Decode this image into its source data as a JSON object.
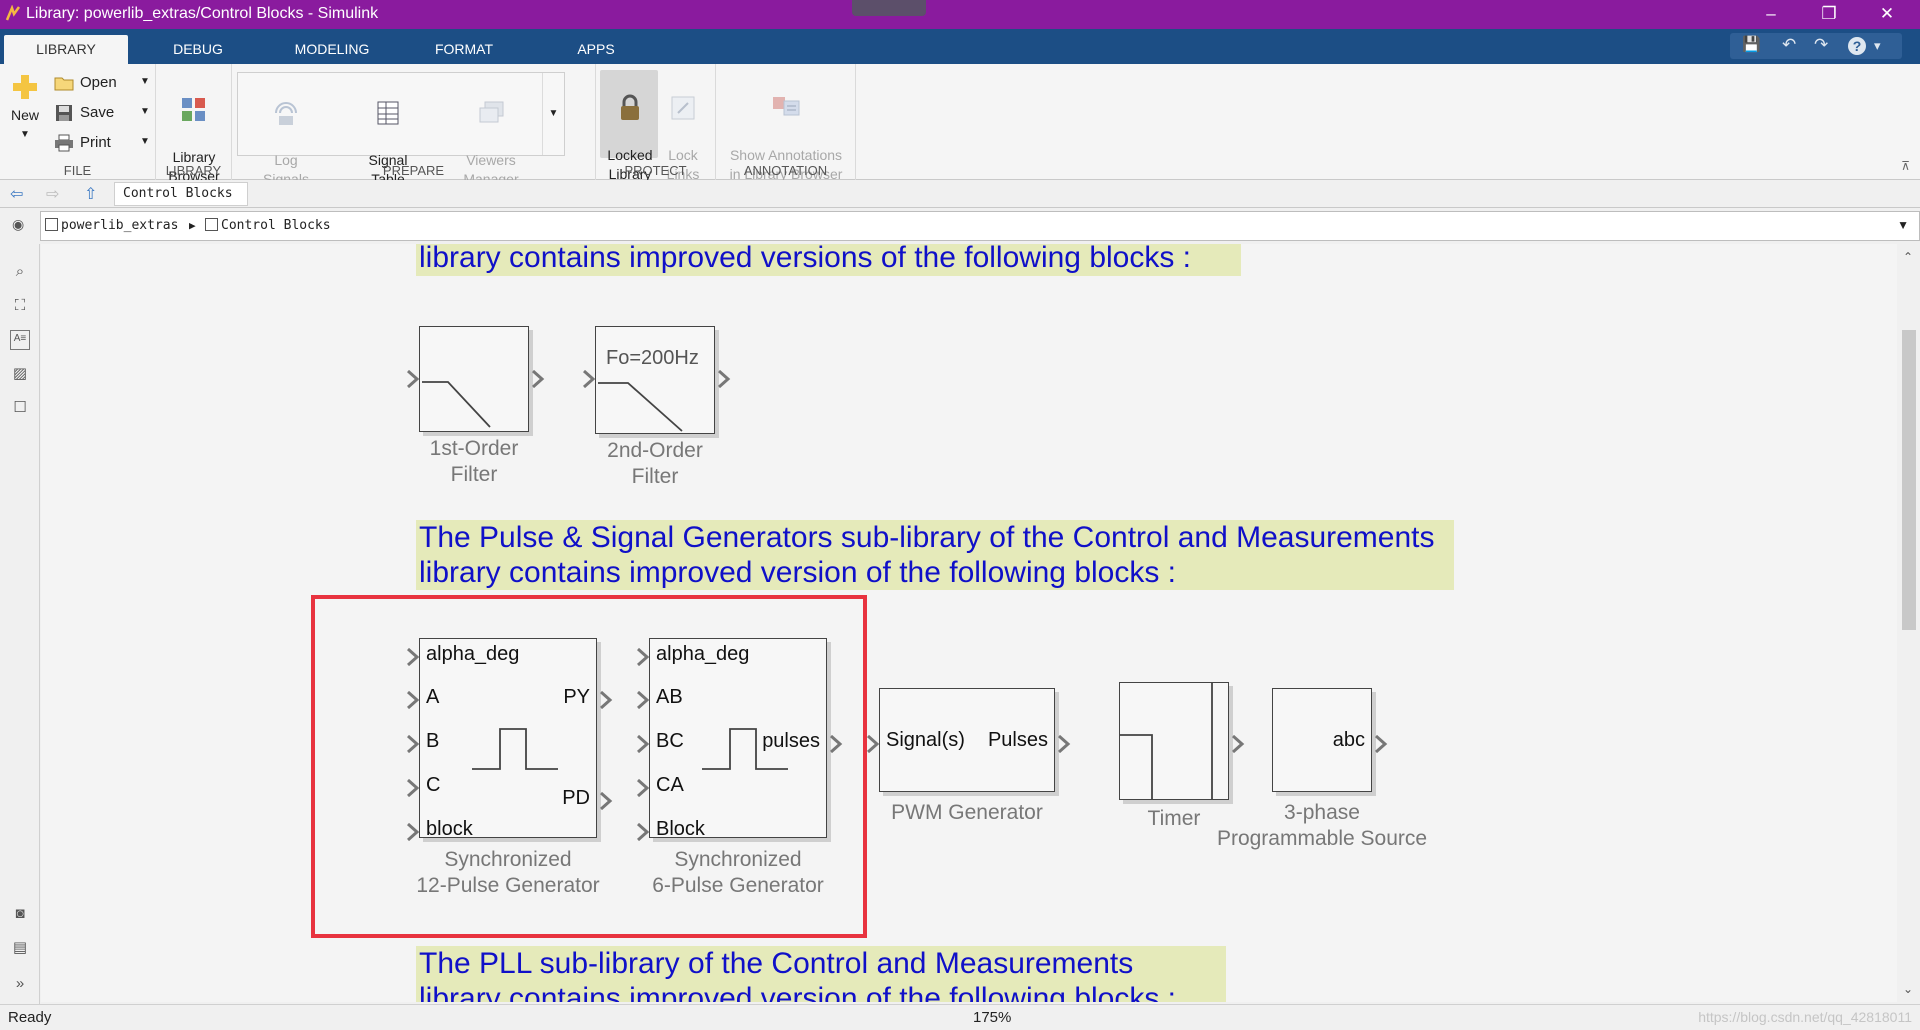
{
  "window": {
    "title": "Library: powerlib_extras/Control  Blocks - Simulink",
    "minimize": "–",
    "restore": "❐",
    "close": "✕"
  },
  "tabs": [
    "LIBRARY",
    "DEBUG",
    "MODELING",
    "FORMAT",
    "APPS"
  ],
  "quick_access": {
    "save": "💾",
    "undo": "↶",
    "redo": "↷",
    "help": "?",
    "more": "▾"
  },
  "ribbon": {
    "file": {
      "caption": "FILE",
      "new_label": "New",
      "open_label": "Open",
      "save_label": "Save",
      "print_label": "Print"
    },
    "library": {
      "caption": "LIBRARY",
      "library_browser_label": "Library\nBrowser"
    },
    "prepare": {
      "caption": "PREPARE",
      "log_signals_label": "Log\nSignals",
      "signal_table_label": "Signal\nTable",
      "viewers_manager_label": "Viewers\nManager"
    },
    "protect": {
      "caption": "PROTECT",
      "locked_library_label": "Locked\nLibrary",
      "lock_links_label": "Lock\nLinks"
    },
    "annotation": {
      "caption": "ANNOTATION",
      "show_annotations_label": "Show Annotations\nin Library Browser"
    }
  },
  "nav": {
    "back": "⇦",
    "forward": "⇨",
    "up": "⇧",
    "tab_label": "Control  Blocks"
  },
  "address": {
    "crumb_root": "powerlib_extras",
    "crumb_sep": "▶",
    "crumb_current": "Control  Blocks",
    "dropdown": "▼"
  },
  "canvas": {
    "annotations": [
      "library contains improved versions of the following blocks :",
      "The Pulse & Signal Generators sub-library of the Control and Measurements\nlibrary contains improved version of the following blocks :",
      "The PLL sub-library of the Control and Measurements\nlibrary contains improved version of the following blocks :"
    ],
    "blocks": {
      "first_order_filter": {
        "name": "1st-Order\nFilter"
      },
      "second_order_filter": {
        "name": "2nd-Order\nFilter",
        "param": "Fo=200Hz"
      },
      "sync12": {
        "name": "Synchronized\n12-Pulse Generator",
        "in_ports": [
          "alpha_deg",
          "A",
          "B",
          "C",
          "block"
        ],
        "out_ports": [
          "PY",
          "PD"
        ]
      },
      "sync6": {
        "name": "Synchronized\n6-Pulse Generator",
        "in_ports": [
          "alpha_deg",
          "AB",
          "BC",
          "CA",
          "Block"
        ],
        "out_ports": [
          "pulses"
        ]
      },
      "pwm": {
        "name": "PWM Generator",
        "in_port": "Signal(s)",
        "out_port": "Pulses"
      },
      "timer": {
        "name": "Timer"
      },
      "three_phase": {
        "name": "3-phase\nProgrammable Source",
        "out_port": "abc"
      }
    }
  },
  "status": {
    "state": "Ready",
    "zoom": "175%",
    "watermark": "https://blog.csdn.net/qq_42818011"
  },
  "colors": {
    "titlebar": "#8a1b9e",
    "tabstrip": "#1c4e85",
    "annotation_bg": "#e5eaba",
    "annotation_text": "#1010c8",
    "highlight": "#e8333f"
  }
}
